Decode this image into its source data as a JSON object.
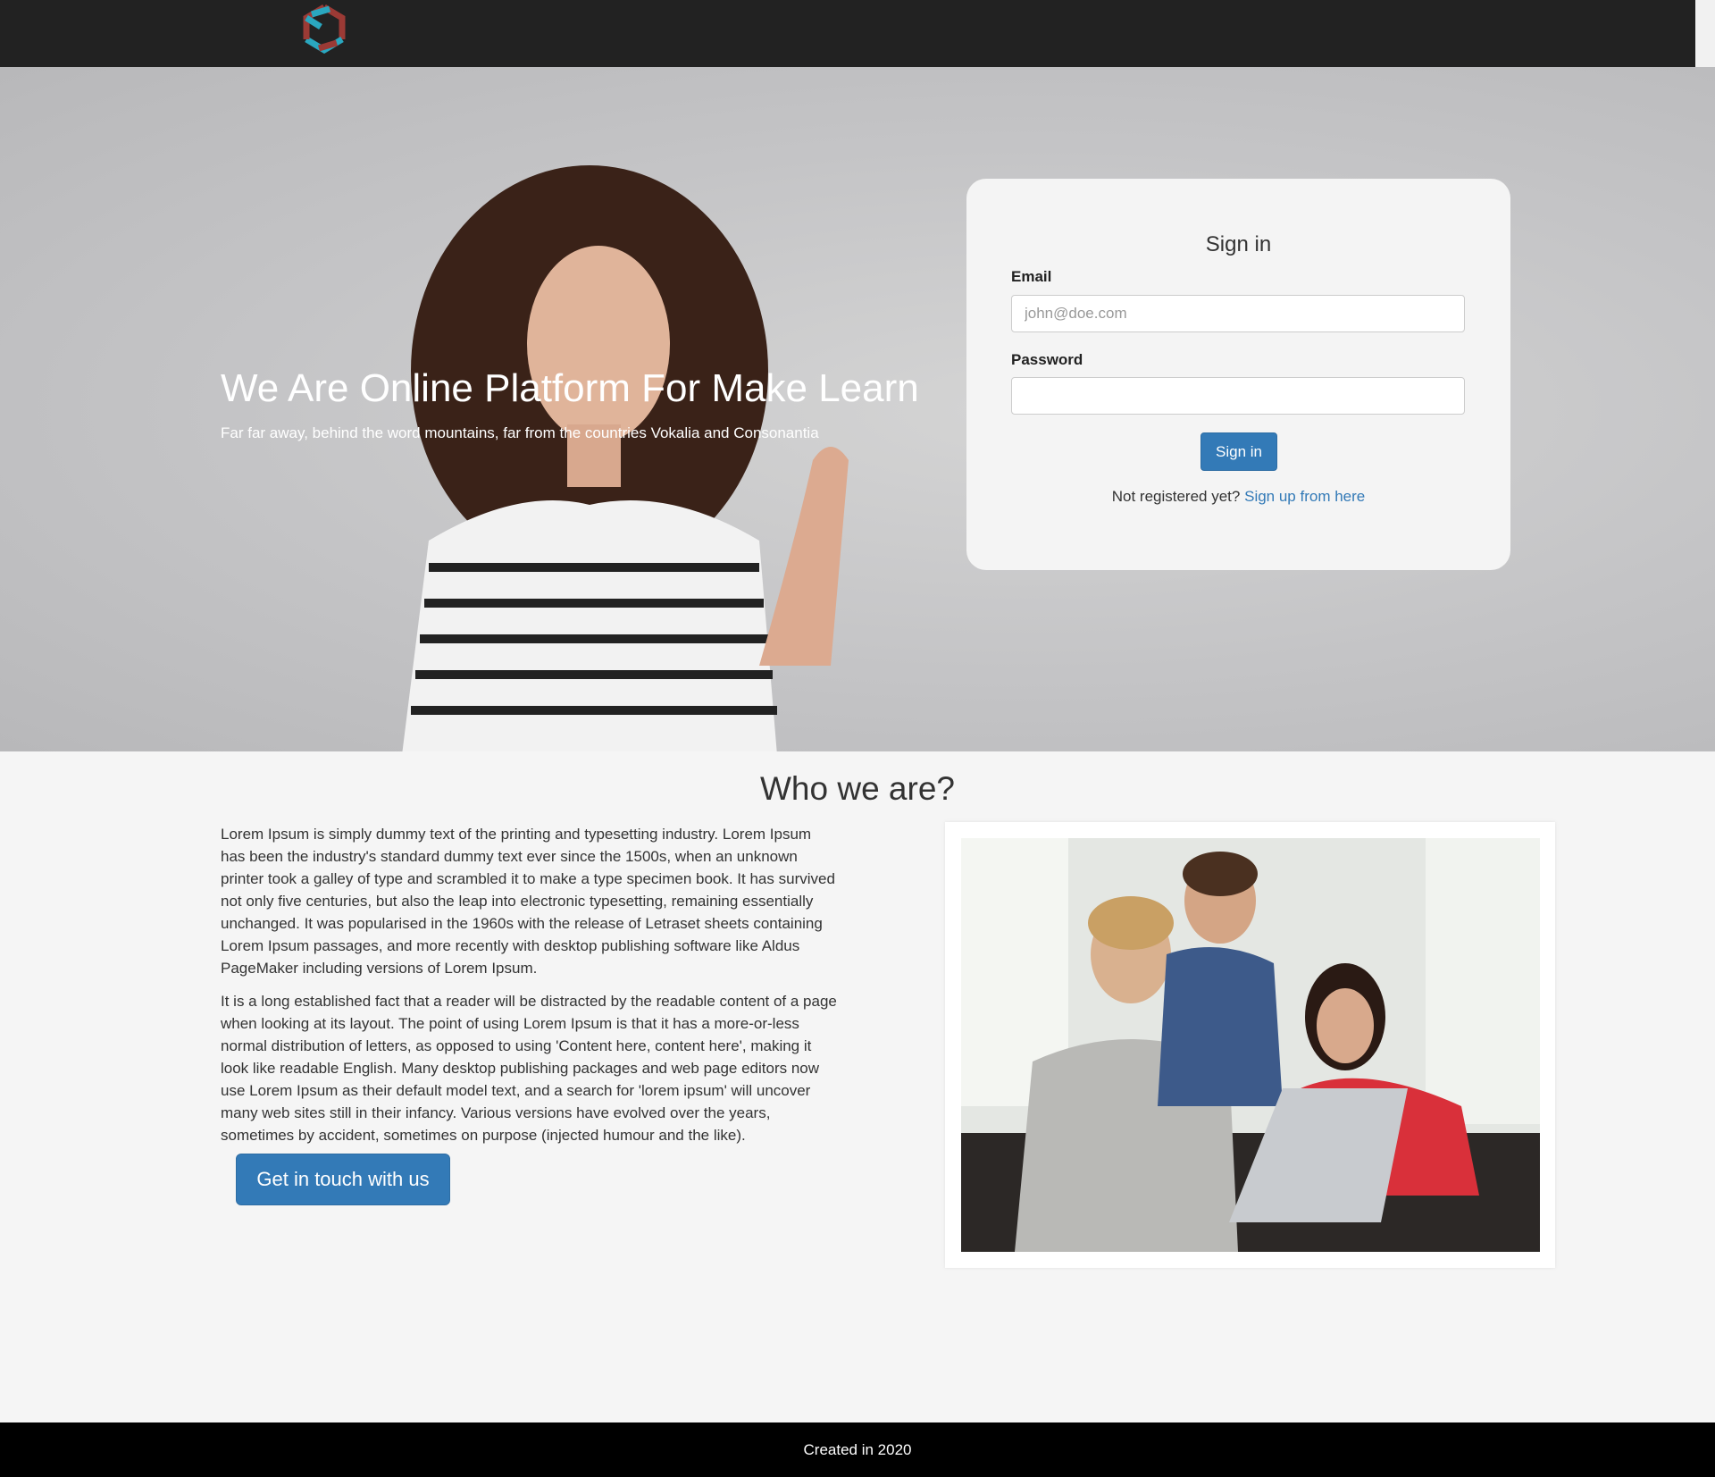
{
  "colors": {
    "header_bg": "#222222",
    "accent": "#337ab7",
    "footer_bg": "#000000",
    "logo_teal": "#2aa7bf",
    "logo_red": "#9b3a35"
  },
  "header": {
    "logo_icon": "hexagon-swirl-logo"
  },
  "hero": {
    "title": "We Are Online Platform For Make Learn",
    "subtitle": "Far far away, behind the word mountains, far from the countries Vokalia and Consonantia"
  },
  "signin": {
    "title": "Sign in",
    "email_label": "Email",
    "email_placeholder": "john@doe.com",
    "email_value": "",
    "password_label": "Password",
    "password_value": "",
    "button": "Sign in",
    "register_prompt": "Not registered yet?",
    "register_link": "Sign up from here"
  },
  "about": {
    "heading": "Who we are?",
    "paragraphs": [
      "Lorem Ipsum is simply dummy text of the printing and typesetting industry. Lorem Ipsum has been the industry's standard dummy text ever since the 1500s, when an unknown printer took a galley of type and scrambled it to make a type specimen book. It has survived not only five centuries, but also the leap into electronic typesetting, remaining essentially unchanged. It was popularised in the 1960s with the release of Letraset sheets containing Lorem Ipsum passages, and more recently with desktop publishing software like Aldus PageMaker including versions of Lorem Ipsum.",
      "It is a long established fact that a reader will be distracted by the readable content of a page when looking at its layout. The point of using Lorem Ipsum is that it has a more-or-less normal distribution of letters, as opposed to using 'Content here, content here', making it look like readable English. Many desktop publishing packages and web page editors now use Lorem Ipsum as their default model text, and a search for 'lorem ipsum' will uncover many web sites still in their infancy. Various versions have evolved over the years, sometimes by accident, sometimes on purpose (injected humour and the like)."
    ],
    "button": "Get in touch with us"
  },
  "footer": {
    "text": "Created in 2020"
  }
}
